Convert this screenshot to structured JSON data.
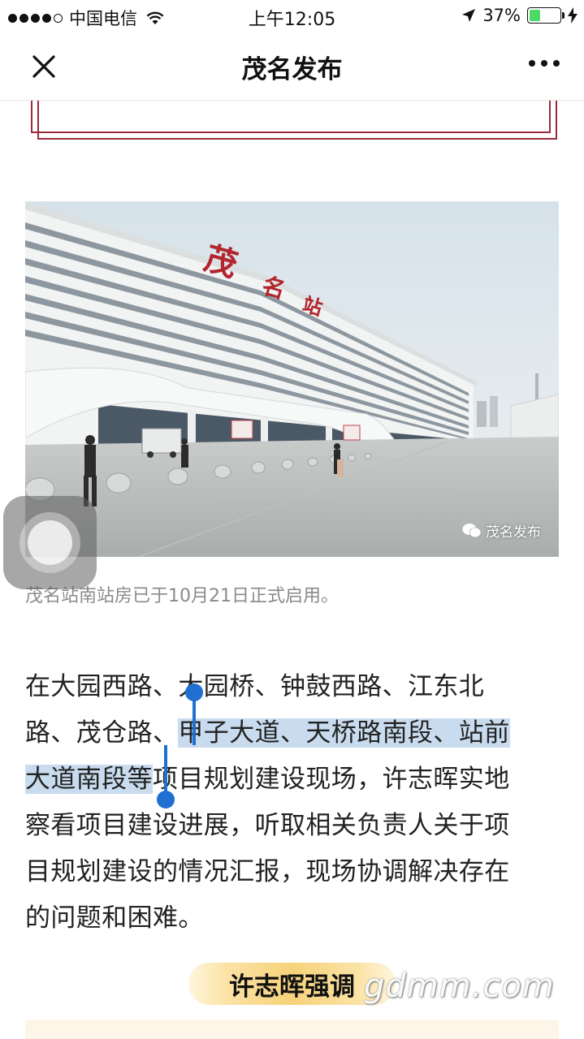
{
  "status_bar": {
    "carrier": "中国电信",
    "time": "上午12:05",
    "battery": "37%",
    "battery_level": 0.37
  },
  "nav": {
    "title": "茂名发布"
  },
  "photo": {
    "watermark": "茂名发布",
    "sign_chars": [
      "茂",
      "名",
      "站"
    ]
  },
  "caption": "茂名站南站房已于10月21日正式启用。",
  "paragraph": {
    "line1": "在大园西路、大园桥、钟鼓西路、江东北",
    "line2_a": "路、茂仓路、",
    "line2_b": "甲子大道、天桥路南段、站前",
    "line3_a": "大道南段等",
    "line3_b": "项目规划建设现场，许志晖实地",
    "line4": "察看项目建设进展，听取相关负责人关于项",
    "line5": "目规划建设的情况汇报，现场协调解决存在",
    "line6": "的问题和困难。"
  },
  "section": {
    "title": "许志晖强调"
  },
  "site_watermark": "gdmm.com",
  "colors": {
    "selection": "#c9dcef",
    "handle": "#1f70d1",
    "accent_frame": "#9a2a3a",
    "battery": "#4cd964"
  }
}
